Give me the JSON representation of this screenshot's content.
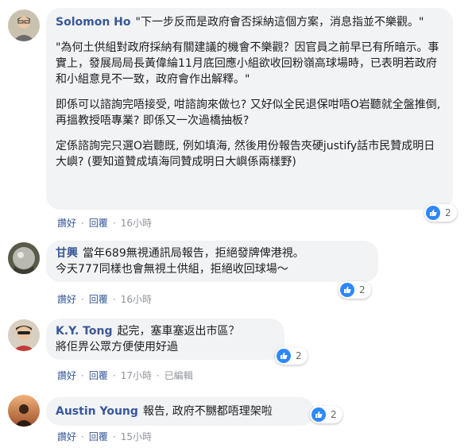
{
  "comments": [
    {
      "author": "Solomon Ho",
      "paragraphs": [
        "\"下一步反而是政府會否採納這個方案，消息指並不樂觀。\"",
        "\"為何土供組對政府採納有關建議的機會不樂觀？因官員之前早已有所暗示。事實上，發展局局長黃偉綸11月底回應小組欲收回粉嶺高球場時，已表明若政府和小組意見不一致，政府會作出解釋。\"",
        "即係可以諮詢完唔接受, 咁諮詢來做乜? 又好似全民退保咁唔O岩聽就全盤推倒, 再搵教授唔專業? 即係又一次過橋抽板?",
        "定係諮詢完只選O岩聽既, 例如填海, 然後用份報告夾硬justify話市民贊成明日大嶼? (要知道贊成填海同贊成明日大嶼係兩樣野)"
      ],
      "like_label": "讚好",
      "reply_label": "回覆",
      "time": "16小時",
      "reaction_count": "2"
    },
    {
      "author": "甘興",
      "paragraphs": [
        "當年689無視通訊局報告，拒絕發牌俾港視。\n今天777同樣也會無視土供組，拒絕收回球場～"
      ],
      "like_label": "讚好",
      "reply_label": "回覆",
      "time": "16小時",
      "reaction_count": "2"
    },
    {
      "author": "K.Y. Tong",
      "paragraphs": [
        "起完，塞車塞返出市區？\n將佢畀公眾方便使用好過"
      ],
      "like_label": "讚好",
      "reply_label": "回覆",
      "time": "17小時",
      "edited": "已編輯",
      "reaction_count": "2"
    },
    {
      "author": "Austin Young",
      "paragraphs": [
        "報告, 政府不嬲都唔理架啦"
      ],
      "like_label": "讚好",
      "reply_label": "回覆",
      "time": "15小時",
      "reaction_count": "2"
    }
  ],
  "colors": {
    "author": "#385898",
    "bubble": "#f2f3f5",
    "like": "#2d88ff",
    "meta": "#90949c"
  }
}
